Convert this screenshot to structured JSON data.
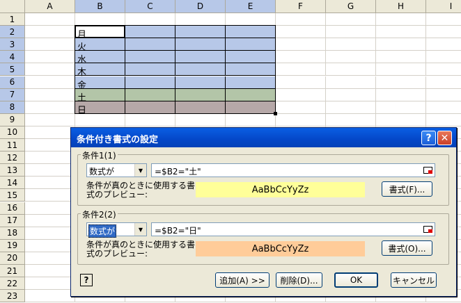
{
  "sheet": {
    "columns": [
      "A",
      "B",
      "C",
      "D",
      "E",
      "F",
      "G",
      "H",
      "I"
    ],
    "rows": [
      "1",
      "2",
      "3",
      "4",
      "5",
      "6",
      "7",
      "8",
      "9",
      "10",
      "11",
      "12",
      "13",
      "14",
      "15",
      "16",
      "17",
      "18",
      "19",
      "20",
      "21",
      "22",
      "23"
    ],
    "day_cells": [
      "月",
      "火",
      "水",
      "木",
      "金",
      "土",
      "日"
    ],
    "colors": {
      "blue": "#b7c8e8",
      "green": "#b3c5a8",
      "mauve": "#b6a8a8"
    }
  },
  "dialog": {
    "title": "条件付き書式の設定",
    "help_icon": "question-icon",
    "close_icon": "close-icon",
    "condition1": {
      "label": "条件1(1)",
      "type": "数式が",
      "formula": "=$B2=\"土\"",
      "preview_label": "条件が真のときに使用する書式のプレビュー:",
      "preview_text": "AaBbCcYyZz",
      "preview_color": "#ffff99",
      "format_button": "書式(F)..."
    },
    "condition2": {
      "label": "条件2(2)",
      "type": "数式が",
      "formula": "=$B2=\"日\"",
      "preview_label": "条件が真のときに使用する書式のプレビュー:",
      "preview_text": "AaBbCcYyZz",
      "preview_color": "#ffcc99",
      "format_button": "書式(O)..."
    },
    "buttons": {
      "add": "追加(A) >>",
      "delete": "削除(D)...",
      "ok": "OK",
      "cancel": "キャンセル"
    }
  }
}
